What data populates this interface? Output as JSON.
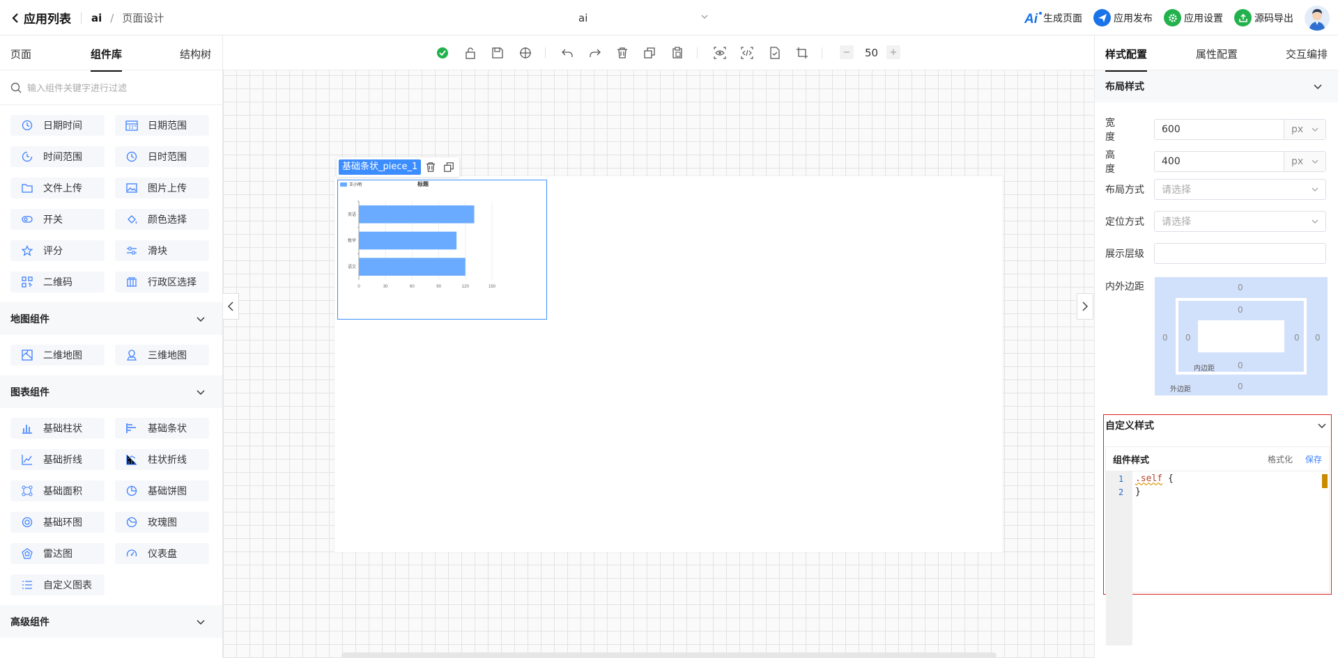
{
  "header": {
    "back_label": "应用列表",
    "app_name": "ai",
    "separator": "/",
    "page_name": "页面设计",
    "center_title": "ai",
    "actions": [
      {
        "label": "生成页面",
        "icon": "ai-icon",
        "color": "#1a73e8"
      },
      {
        "label": "应用发布",
        "icon": "send-icon",
        "color": "#1a73e8"
      },
      {
        "label": "应用设置",
        "icon": "gear-icon",
        "color": "#22b14c"
      },
      {
        "label": "源码导出",
        "icon": "export-icon",
        "color": "#22b14c"
      }
    ]
  },
  "left": {
    "tabs": [
      "页面",
      "组件库",
      "结构树"
    ],
    "active_tab": "组件库",
    "search_placeholder": "输入组件关键字进行过滤",
    "basic_components": [
      "日期时间",
      "日期范围",
      "时间范围",
      "日时范围",
      "文件上传",
      "图片上传",
      "开关",
      "颜色选择",
      "评分",
      "滑块",
      "二维码",
      "行政区选择"
    ],
    "map_section": "地图组件",
    "map_components": [
      "二维地图",
      "三维地图"
    ],
    "chart_section": "图表组件",
    "chart_components": [
      "基础柱状",
      "基础条状",
      "基础折线",
      "柱状折线",
      "基础面积",
      "基础饼图",
      "基础环图",
      "玫瑰图",
      "雷达图",
      "仪表盘",
      "自定义图表"
    ],
    "advanced_section": "高级组件"
  },
  "toolbar": {
    "zoom": "50",
    "zoom_minus": "−",
    "zoom_plus": "+"
  },
  "selected_component": {
    "name": "基础条状_piece_1"
  },
  "chart_data": {
    "type": "bar",
    "orientation": "horizontal",
    "title": "标题",
    "legend": "王小明",
    "categories": [
      "英语",
      "数学",
      "语文"
    ],
    "series": [
      {
        "name": "王小明",
        "values": [
          130,
          110,
          120
        ]
      }
    ],
    "x_ticks": [
      "0",
      "30",
      "60",
      "90",
      "120",
      "150"
    ],
    "xlim": [
      0,
      150
    ],
    "color": "#6aabff"
  },
  "right": {
    "tabs": [
      "样式配置",
      "属性配置",
      "交互编排"
    ],
    "active_tab": "样式配置",
    "layout_section": "布局样式",
    "width_label": "宽 度",
    "width_value": "600",
    "height_label": "高 度",
    "height_value": "400",
    "unit": "px",
    "layout_mode_label": "布局方式",
    "position_label": "定位方式",
    "select_placeholder": "请选择",
    "zindex_label": "展示层级",
    "spacing_label": "内外边距",
    "padding_label": "内边距",
    "margin_label": "外边距",
    "margin_values": {
      "top": "0",
      "right": "0",
      "bottom": "0",
      "left": "0"
    },
    "padding_values": {
      "top": "0",
      "right": "0",
      "bottom": "0",
      "left": "0"
    },
    "custom_section": "自定义样式",
    "editor_title": "组件样式",
    "format_label": "格式化",
    "save_label": "保存",
    "code_lines": [
      {
        "num": "1",
        "selector": ".self",
        "rest": " {"
      },
      {
        "num": "2",
        "selector": "",
        "rest": " }"
      }
    ]
  }
}
